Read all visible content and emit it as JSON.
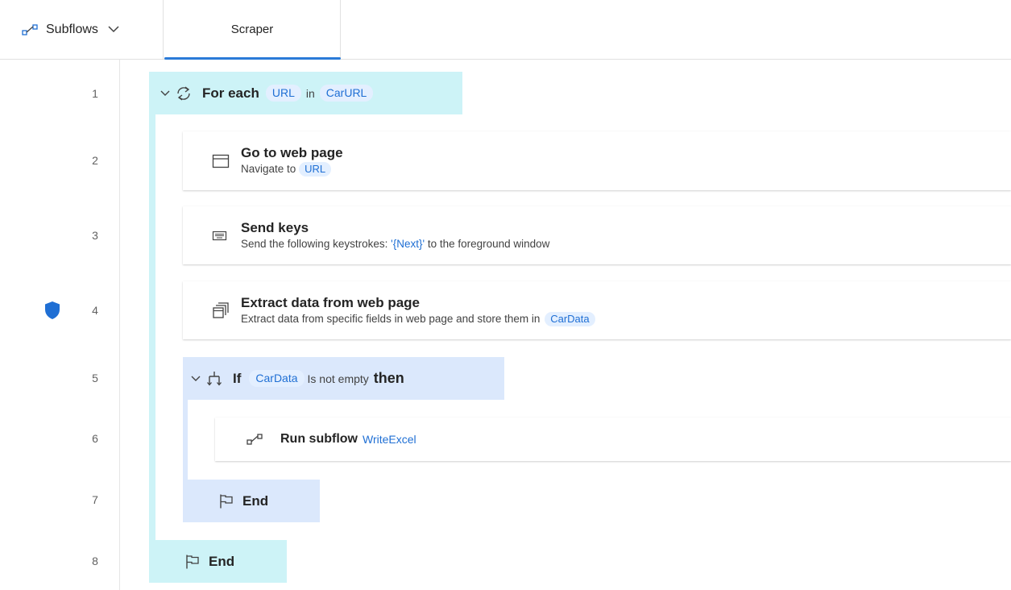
{
  "tabs": {
    "subflows_label": "Subflows",
    "scraper_label": "Scraper"
  },
  "line_numbers": [
    "1",
    "2",
    "3",
    "4",
    "5",
    "6",
    "7",
    "8"
  ],
  "actions": {
    "for_each": {
      "keyword": "For each",
      "variable": "URL",
      "in_label": "in",
      "collection": "CarURL"
    },
    "go_to_web_page": {
      "title": "Go to web page",
      "desc_prefix": "Navigate to",
      "variable": "URL"
    },
    "send_keys": {
      "title": "Send keys",
      "desc_prefix": "Send the following keystrokes:",
      "keystrokes": "'{Next}'",
      "desc_suffix": "to the foreground window"
    },
    "extract_data": {
      "title": "Extract data from web page",
      "desc_prefix": "Extract data from specific fields in web page and store them in",
      "variable": "CarData"
    },
    "if": {
      "keyword": "If",
      "variable": "CarData",
      "condition": "Is not empty",
      "then_label": "then"
    },
    "run_subflow": {
      "title": "Run subflow",
      "subflow_name": "WriteExcel"
    },
    "if_end": {
      "label": "End"
    },
    "loop_end": {
      "label": "End"
    }
  },
  "colors": {
    "accent": "#2b7bd8",
    "loop_bg": "#cdf3f7",
    "if_bg": "#dbe8fc",
    "pill_bg": "#e3efff",
    "pill_text": "#1f6fd4",
    "breakpoint": "#1f6fd4"
  },
  "icons": {
    "subflows": "subflow-icon",
    "loop": "loop-icon",
    "web_page": "browser-window-icon",
    "keyboard": "keyboard-icon",
    "extract": "extract-data-icon",
    "if": "branch-icon",
    "end": "flag-icon",
    "breakpoint": "shield-icon"
  }
}
